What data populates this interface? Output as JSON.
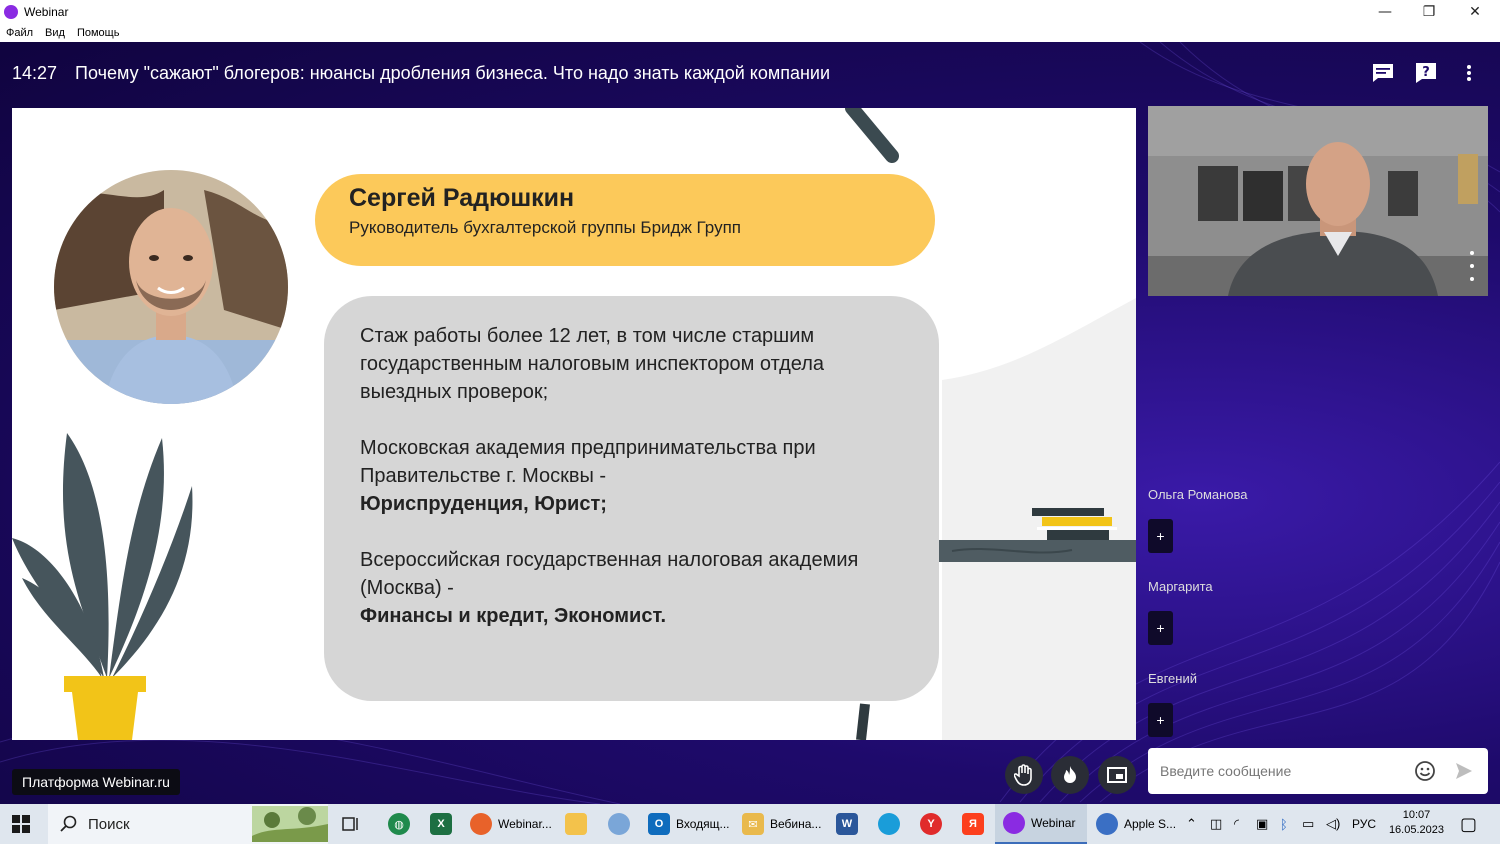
{
  "window": {
    "app_title": "Webinar",
    "minimize": "—",
    "maximize": "❐",
    "close": "✕"
  },
  "menu": {
    "file": "Файл",
    "view": "Вид",
    "help": "Помощь"
  },
  "header": {
    "time": "14:27",
    "title": "Почему \"сажают\" блогеров: нюансы дробления бизнеса. Что надо знать каждой компании"
  },
  "slide": {
    "speaker_name": "Сергей Радюшкин",
    "speaker_role": "Руководитель бухгалтерской группы Бридж Групп",
    "bio": {
      "p1": "Стаж работы более 12 лет, в том числе старшим государственным налоговым инспектором отдела выездных проверок;",
      "p2_line": "Московская академия предпринимательства при Правительстве г. Москвы -",
      "p2_bold": "Юриспруденция, Юрист;",
      "p3_line": "Всероссийская государственная налоговая академия (Москва) -",
      "p3_bold": "Финансы и кредит, Экономист."
    }
  },
  "participants": [
    {
      "name": "Ольга Романова",
      "button": "+"
    },
    {
      "name": "Маргарита",
      "button": "+"
    },
    {
      "name": "Евгений",
      "button": "+"
    }
  ],
  "chat": {
    "placeholder": "Введите сообщение"
  },
  "platform_label": "Платформа Webinar.ru",
  "taskbar": {
    "search_label": "Поиск",
    "items": [
      {
        "label": "Webinar..."
      },
      {
        "label": "Входящ..."
      },
      {
        "label": "Вебина..."
      },
      {
        "label": "Webinar"
      },
      {
        "label": "Apple S..."
      }
    ],
    "language": "РУС",
    "time": "10:07",
    "date": "16.05.2023"
  },
  "colors": {
    "accent_yellow": "#fcc95a",
    "bio_gray": "#d6d6d6",
    "stage_purple": "#1e0a6b"
  }
}
